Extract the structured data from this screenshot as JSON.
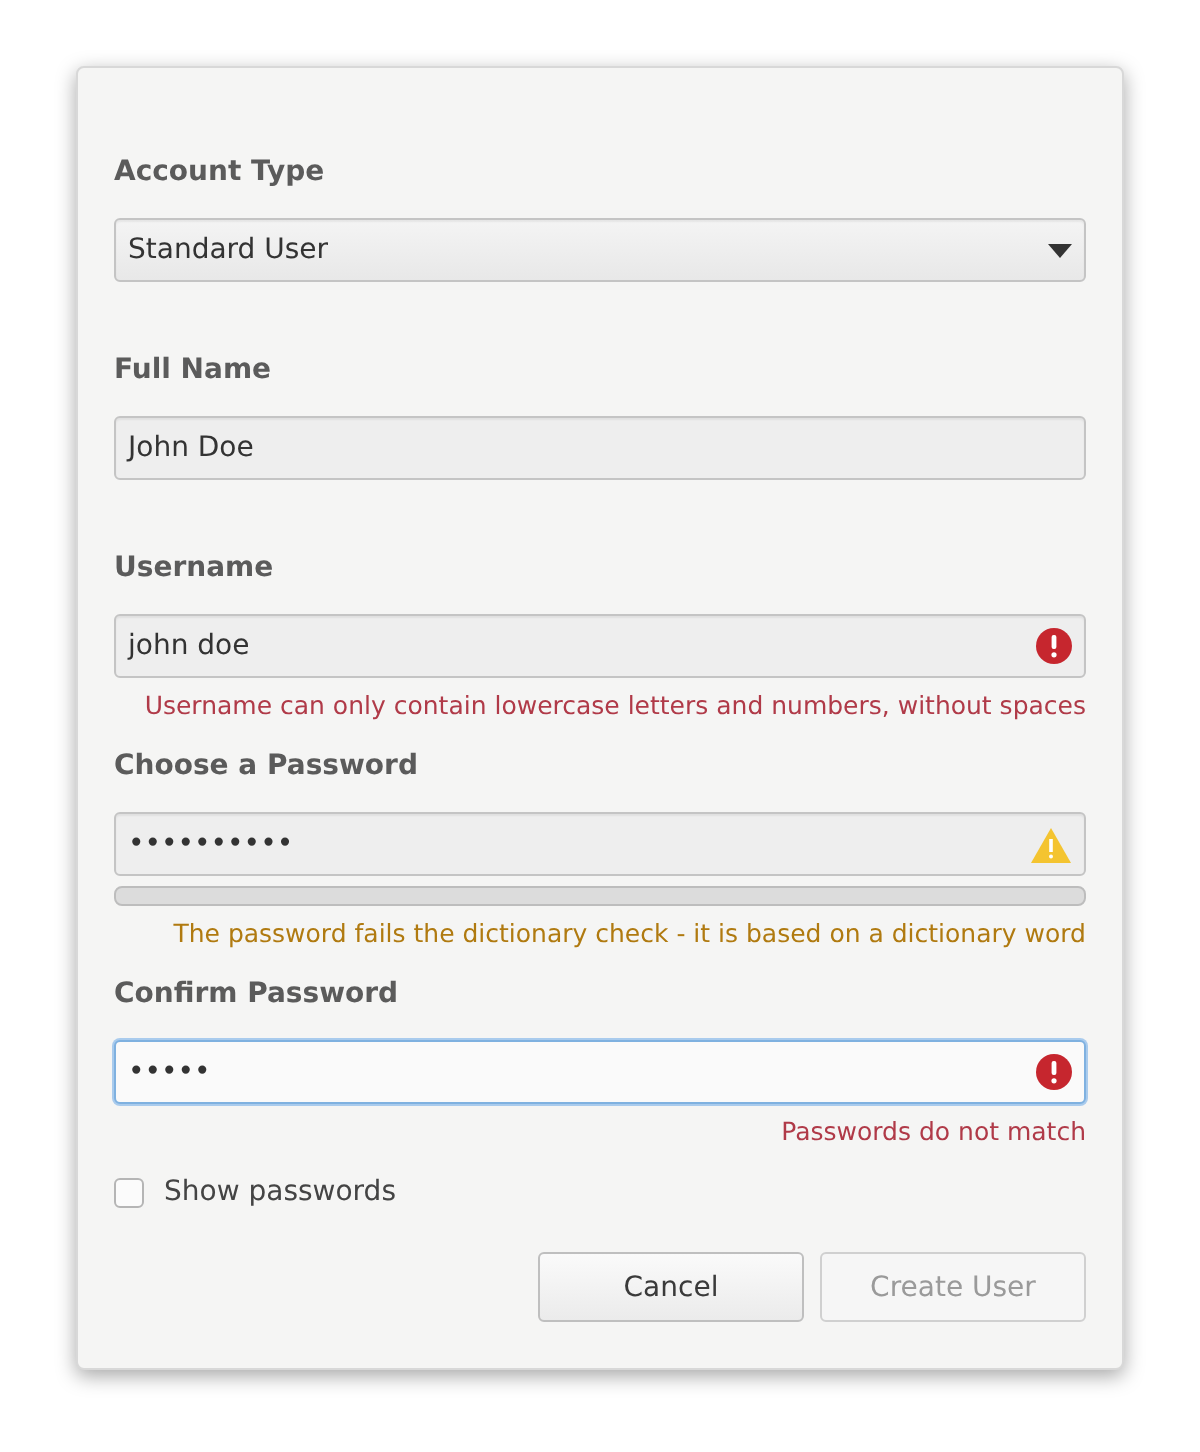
{
  "account_type": {
    "label": "Account Type",
    "value": "Standard User"
  },
  "fields": [
    {
      "label": "Full Name",
      "value": "John Doe",
      "error": false,
      "warning": false,
      "focused": false
    },
    {
      "label": "Username",
      "value": "john doe",
      "error": true,
      "warning": false,
      "focused": false,
      "message": "Username can only contain lowercase letters and numbers, without spaces"
    },
    {
      "label": "Choose a Password",
      "value": "••••••••••",
      "error": false,
      "warning": true,
      "focused": false,
      "strength": {
        "level": 0
      },
      "message": "The password fails the dictionary check - it is based on a dictionary word"
    },
    {
      "label": "Confirm Password",
      "value": "•••••",
      "error": true,
      "warning": false,
      "focused": true,
      "message": "Passwords do not match"
    }
  ],
  "show_passwords": {
    "label": "Show passwords",
    "checked": false
  },
  "buttons": [
    {
      "label": "Cancel",
      "disabled": false
    },
    {
      "label": "Create User",
      "disabled": true
    }
  ]
}
